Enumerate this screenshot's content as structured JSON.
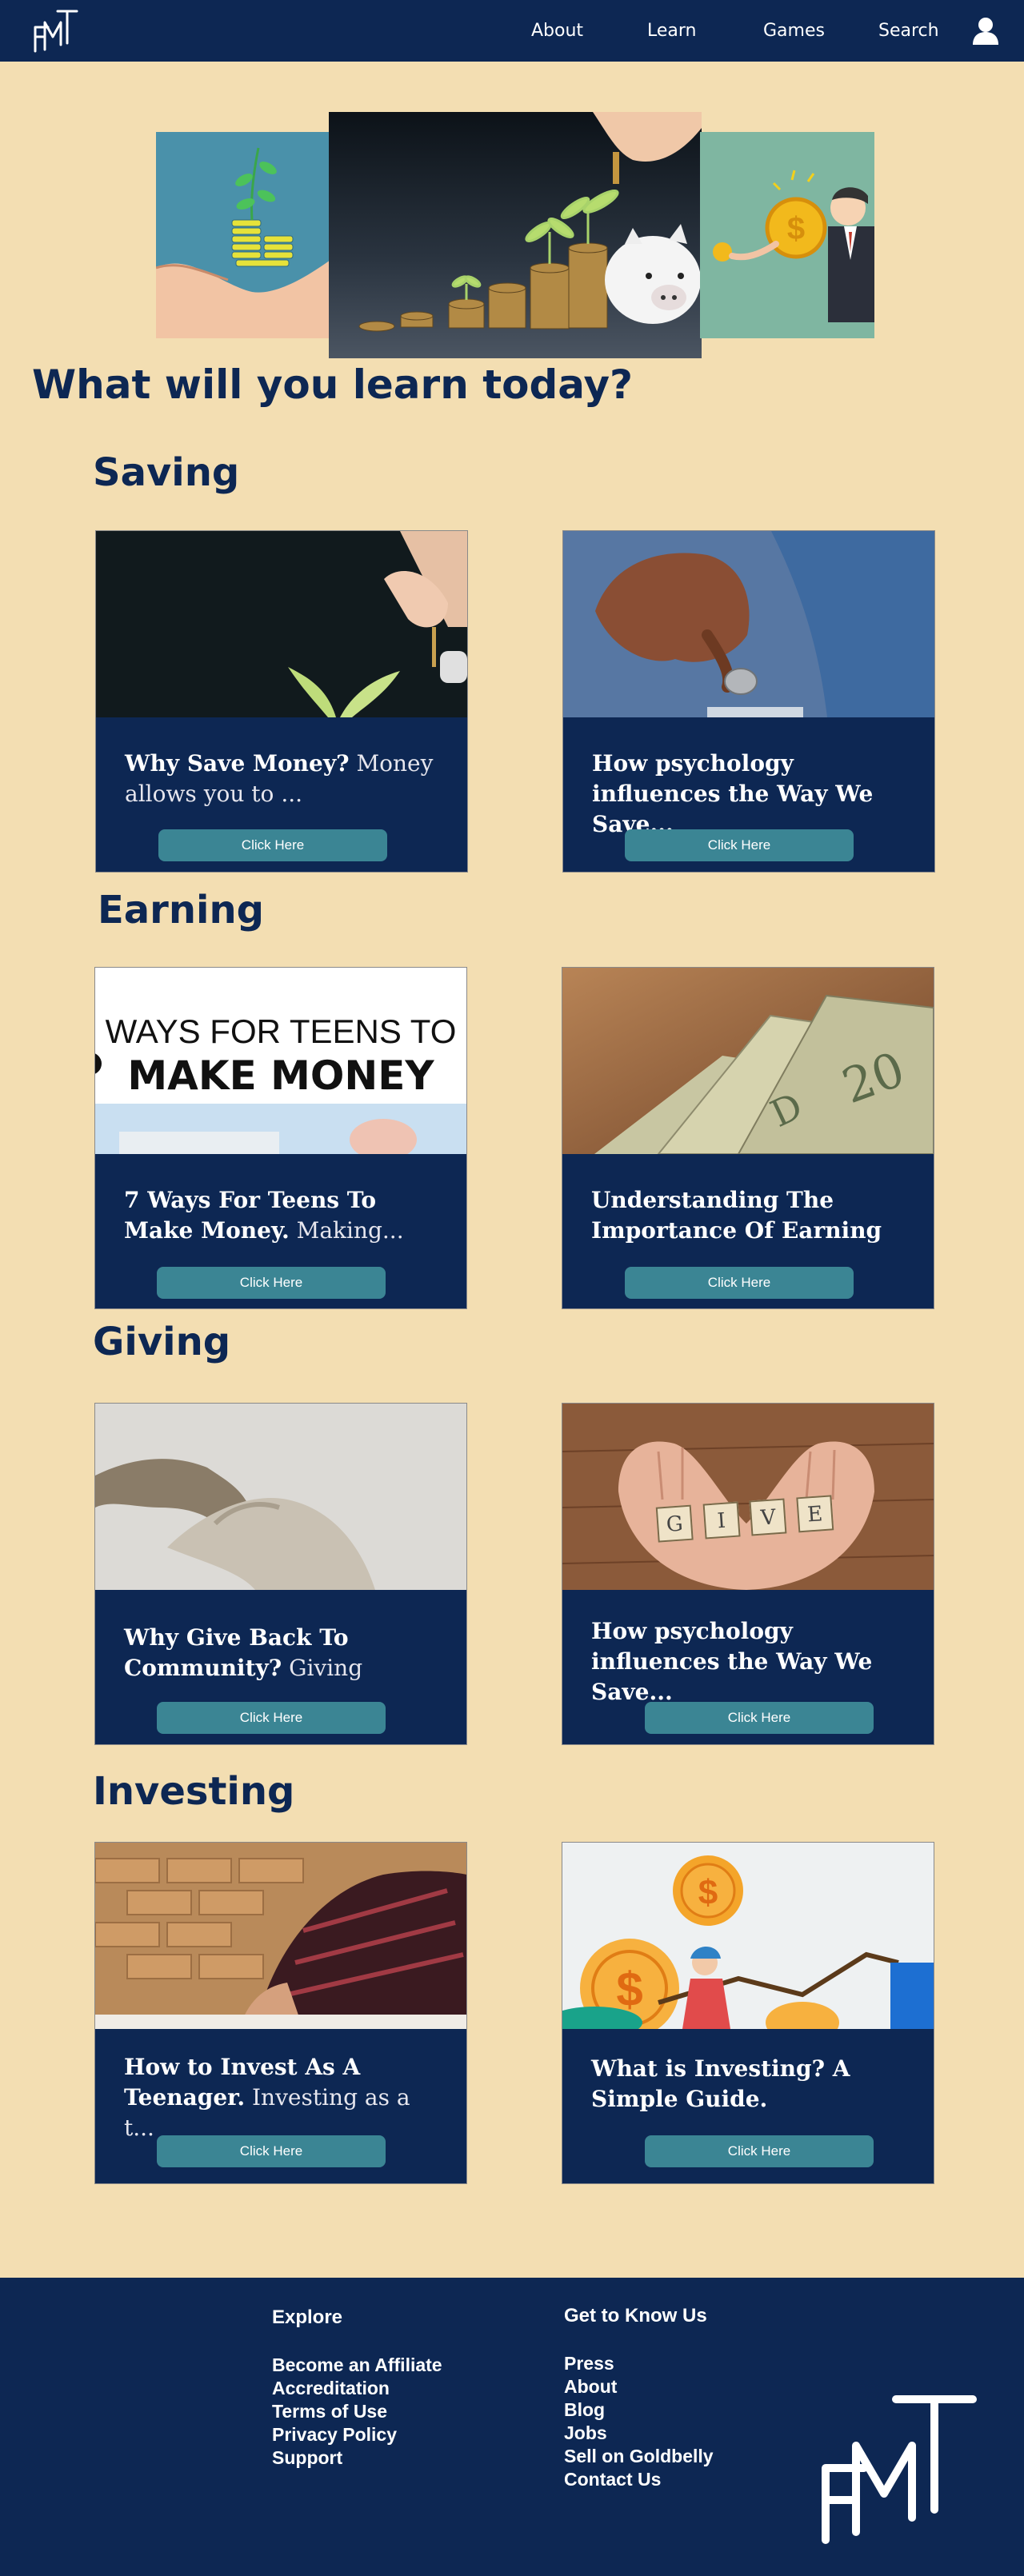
{
  "nav": {
    "logo_icon": "fmt-logo",
    "links": [
      "About",
      "Learn",
      "Games",
      "Search"
    ],
    "user_icon": "user-icon"
  },
  "hero": {
    "images": [
      "hand-coins-plant-image",
      "coins-piggy-bank-image",
      "businessman-coin-image"
    ]
  },
  "main_title": "What will you learn today?",
  "sections": [
    {
      "title": "Saving",
      "cards": [
        {
          "title": "Why Save Money?",
          "snippet": " Money allows you to ...",
          "button": "Click Here"
        },
        {
          "title": "How psychology influences the Way We Save...",
          "snippet": "",
          "button": "Click Here"
        }
      ]
    },
    {
      "title": "Earning",
      "cards": [
        {
          "title": "7 Ways For Teens To Make Money.",
          "snippet": " Making...",
          "button": "Click Here",
          "image_caption_line1": "WAYS FOR TEENS TO",
          "image_caption_line2": "MAKE MONEY"
        },
        {
          "title": "Understanding The Importance Of Earning",
          "snippet": "",
          "button": "Click Here"
        }
      ]
    },
    {
      "title": "Giving",
      "cards": [
        {
          "title": "Why Give Back To Community?",
          "snippet": " Giving",
          "button": "Click Here"
        },
        {
          "title": "How psychology influences the Way We Save...",
          "snippet": "",
          "button": "Click Here",
          "image_word": "GIVE"
        }
      ]
    },
    {
      "title": "Investing",
      "cards": [
        {
          "title": "How to Invest As A Teenager.",
          "snippet": " Investing as a t...",
          "button": "Click Here"
        },
        {
          "title": "What is Investing? A Simple Guide.",
          "snippet": "",
          "button": "Click Here"
        }
      ]
    }
  ],
  "footer": {
    "explore": {
      "heading": "Explore",
      "items": [
        "Become an Affiliate",
        "Accreditation",
        "Terms of Use",
        "Privacy Policy",
        "Support"
      ]
    },
    "know": {
      "heading": "Get to Know Us",
      "items": [
        "Press",
        "About",
        "Blog",
        "Jobs",
        "Sell on Goldbelly",
        "Contact Us"
      ]
    }
  },
  "colors": {
    "navy": "#0d2753",
    "cream": "#f3deb2",
    "teal_button": "#3b8594"
  }
}
